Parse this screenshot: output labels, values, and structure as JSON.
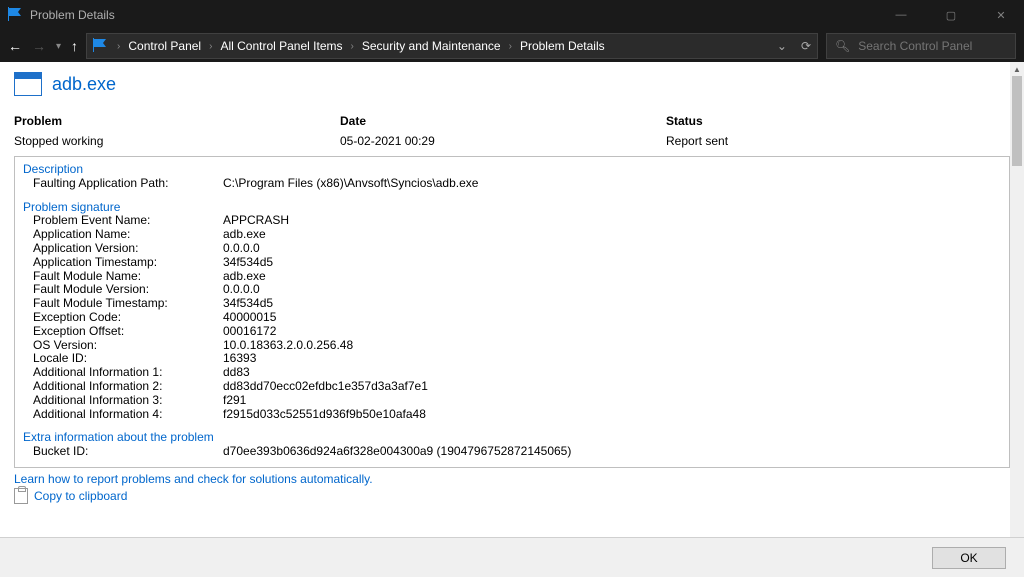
{
  "window": {
    "title": "Problem Details"
  },
  "breadcrumb": {
    "items": [
      "Control Panel",
      "All Control Panel Items",
      "Security and Maintenance",
      "Problem Details"
    ]
  },
  "search": {
    "placeholder": "Search Control Panel"
  },
  "app": {
    "name": "adb.exe"
  },
  "summary": {
    "problem_label": "Problem",
    "problem_value": "Stopped working",
    "date_label": "Date",
    "date_value": "05-02-2021 00:29",
    "status_label": "Status",
    "status_value": "Report sent"
  },
  "sections": {
    "description_title": "Description",
    "description": {
      "k": "Faulting Application Path:",
      "v": "C:\\Program Files (x86)\\Anvsoft\\Syncios\\adb.exe"
    },
    "signature_title": "Problem signature",
    "signature": [
      {
        "k": "Problem Event Name:",
        "v": "APPCRASH"
      },
      {
        "k": "Application Name:",
        "v": "adb.exe"
      },
      {
        "k": "Application Version:",
        "v": "0.0.0.0"
      },
      {
        "k": "Application Timestamp:",
        "v": "34f534d5"
      },
      {
        "k": "Fault Module Name:",
        "v": "adb.exe"
      },
      {
        "k": "Fault Module Version:",
        "v": "0.0.0.0"
      },
      {
        "k": "Fault Module Timestamp:",
        "v": "34f534d5"
      },
      {
        "k": "Exception Code:",
        "v": "40000015"
      },
      {
        "k": "Exception Offset:",
        "v": "00016172"
      },
      {
        "k": "OS Version:",
        "v": "10.0.18363.2.0.0.256.48"
      },
      {
        "k": "Locale ID:",
        "v": "16393"
      },
      {
        "k": "Additional Information 1:",
        "v": "dd83"
      },
      {
        "k": "Additional Information 2:",
        "v": "dd83dd70ecc02efdbc1e357d3a3af7e1"
      },
      {
        "k": "Additional Information 3:",
        "v": "f291"
      },
      {
        "k": "Additional Information 4:",
        "v": "f2915d033c52551d936f9b50e10afa48"
      }
    ],
    "extra_title": "Extra information about the problem",
    "extra": {
      "k": "Bucket ID:",
      "v": "d70ee393b0636d924a6f328e004300a9 (1904796752872145065)"
    }
  },
  "links": {
    "learn": "Learn how to report problems and check for solutions automatically.",
    "copy": "Copy to clipboard"
  },
  "buttons": {
    "ok": "OK"
  }
}
